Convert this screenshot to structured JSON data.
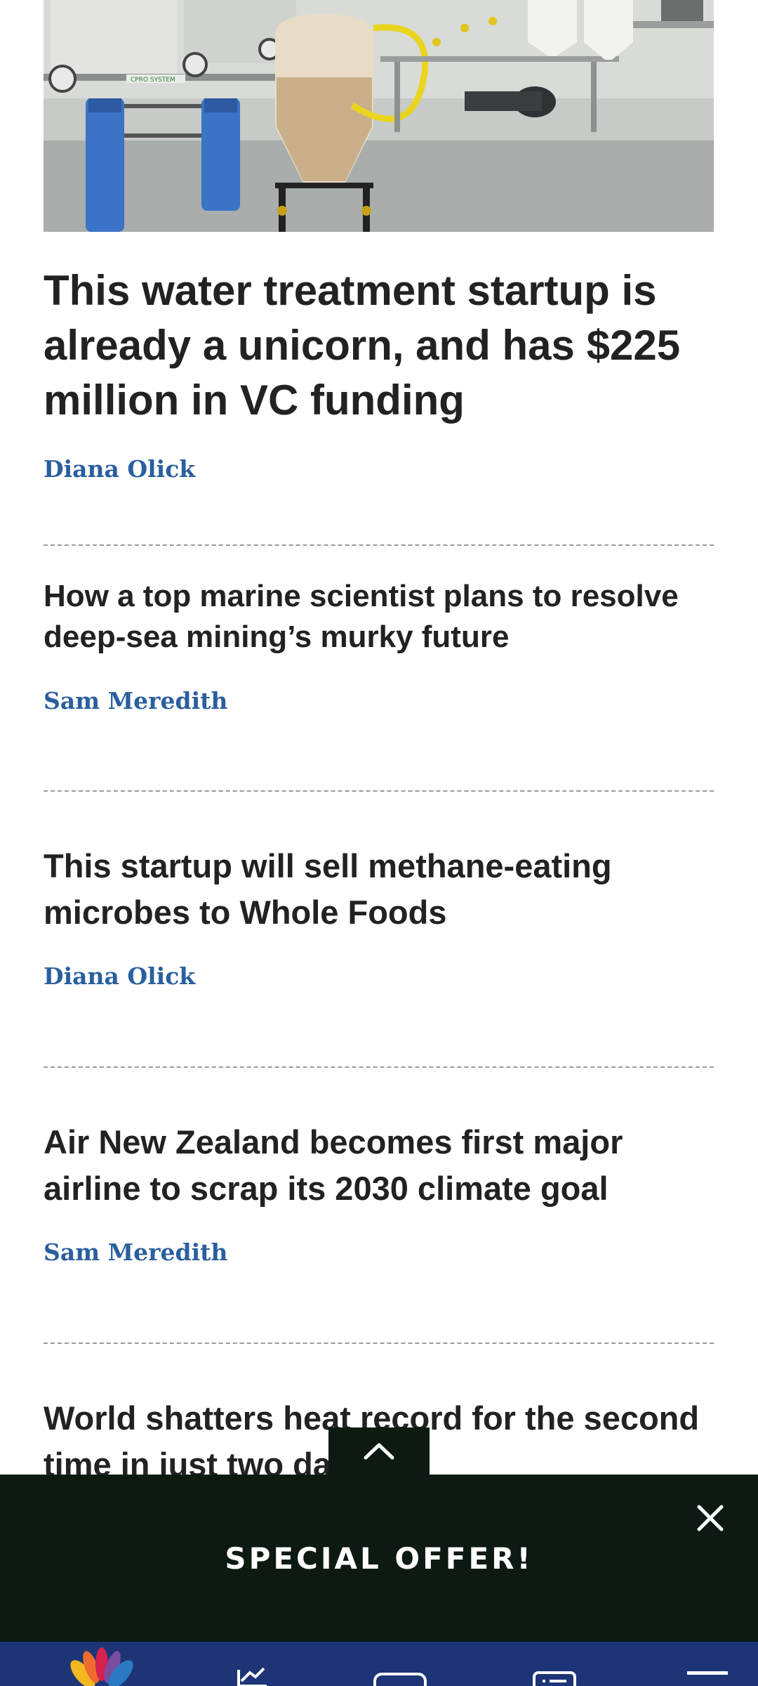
{
  "hero_image": {
    "alt": "water treatment equipment",
    "panel_label": "CPRO SYSTEM"
  },
  "articles": [
    {
      "title": "This water treatment startup is already a unicorn, and has $225 million in VC funding",
      "author": "Diana Olick"
    },
    {
      "title": "How a top marine scientist plans to resolve deep-sea mining’s murky future",
      "author": "Sam Meredith"
    },
    {
      "title": "This startup will sell methane-eating microbes to Whole Foods",
      "author": "Diana Olick"
    },
    {
      "title": "Air New Zealand becomes first major airline to scrap its 2030 climate goal",
      "author": "Sam Meredith"
    },
    {
      "title": "World shatters heat record for the second time in just two days"
    }
  ],
  "offer_banner": {
    "text": "SPECIAL OFFER!",
    "close_icon": "close-icon"
  },
  "scroll_top": {
    "icon": "chevron-up-icon"
  },
  "bottom_nav": {
    "items": [
      {
        "icon": "peacock-logo-icon"
      },
      {
        "icon": "markets-chart-icon"
      },
      {
        "icon": "video-icon"
      },
      {
        "icon": "watchlist-icon"
      },
      {
        "icon": "menu-icon"
      }
    ]
  },
  "colors": {
    "author": "#2a5f9e",
    "banner": "#0c1a12",
    "nav": "#1d3577"
  }
}
